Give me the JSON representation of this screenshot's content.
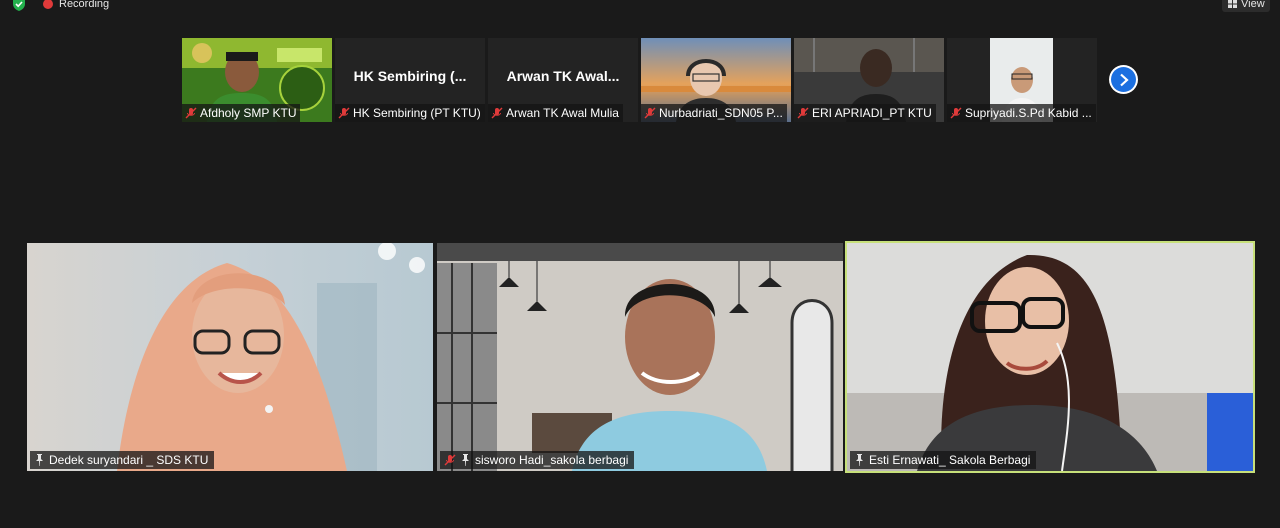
{
  "topbar": {
    "recording_label": "Recording",
    "view_label": "View"
  },
  "thumbnails": [
    {
      "name": "Afdholy SMP KTU",
      "muted": true,
      "has_video": true,
      "overlay_title": ""
    },
    {
      "name": "HK Sembiring (PT KTU)",
      "muted": true,
      "has_video": false,
      "overlay_title": "HK Sembiring (..."
    },
    {
      "name": "Arwan TK Awal Mulia",
      "muted": true,
      "has_video": false,
      "overlay_title": "Arwan TK Awal..."
    },
    {
      "name": "Nurbadriati_SDN05 P...",
      "muted": true,
      "has_video": true,
      "overlay_title": ""
    },
    {
      "name": "ERI APRIADI_PT KTU",
      "muted": true,
      "has_video": true,
      "overlay_title": ""
    },
    {
      "name": "Supriyadi.S.Pd Kabid ...",
      "muted": true,
      "has_video": true,
      "overlay_title": ""
    }
  ],
  "gallery": [
    {
      "name": "Dedek suryandari _ SDS KTU",
      "muted": false,
      "pinned": true,
      "active": false
    },
    {
      "name": "sisworo Hadi_sakola berbagi",
      "muted": true,
      "pinned": true,
      "active": false
    },
    {
      "name": "Esti Ernawati_ Sakola Berbagi",
      "muted": false,
      "pinned": true,
      "active": true
    }
  ],
  "colors": {
    "background": "#1a1a1a",
    "active_speaker_border": "#c7e07a",
    "muted_red": "#e03a3a",
    "next_button_blue": "#1b6fe0"
  },
  "icons": {
    "security": "shield-check-icon",
    "recording": "record-dot-icon",
    "view": "grid-view-icon",
    "muted": "mic-muted-icon",
    "pinned": "pin-icon",
    "next": "chevron-right-icon"
  }
}
